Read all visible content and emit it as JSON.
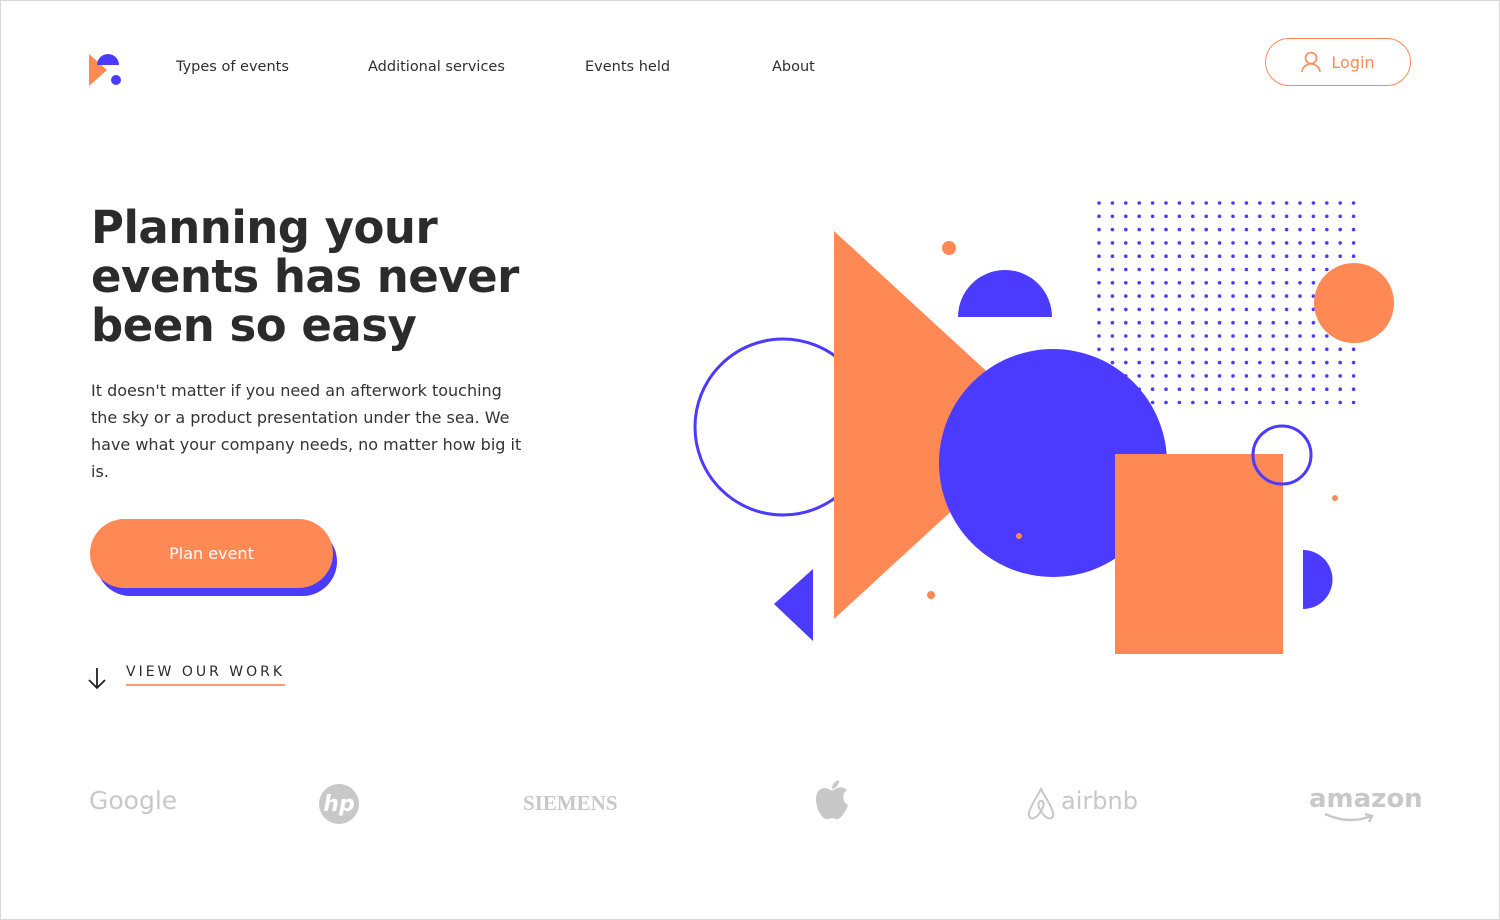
{
  "nav": {
    "items": [
      "Types of events",
      "Additional services",
      "Events held",
      "About"
    ],
    "login_label": "Login"
  },
  "hero": {
    "title": "Planning your events has never been so easy",
    "lead": "It doesn't matter if you need an afterwork touching the sky or a product presentation under the sea. We have what your company needs, no matter how big it is.",
    "cta_label": "Plan event",
    "view_work_label": "VIEW OUR WORK"
  },
  "logos": [
    "Google",
    "hp",
    "SIEMENS",
    "Apple",
    "airbnb",
    "amazon"
  ],
  "colors": {
    "accent": "#ff8955",
    "primary": "#4b3bff",
    "logo_gray": "#c8c8c8"
  }
}
